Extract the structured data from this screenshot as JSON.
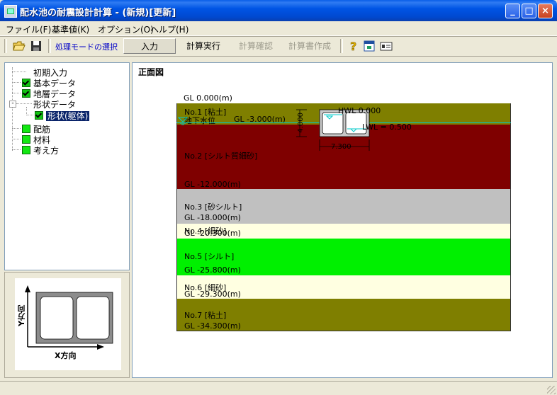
{
  "window": {
    "title": "配水池の耐震設計計算 - (新規)[更新]",
    "controls": {
      "minimize": "_",
      "maximize": "□",
      "close": "×"
    }
  },
  "menu": [
    "ファイル(F)",
    "基準値(K)",
    "オプション(O)",
    "ヘルプ(H)"
  ],
  "toolbar": {
    "mode_label": "処理モードの選択",
    "modes": [
      {
        "label": "入力",
        "state": "active"
      },
      {
        "label": "計算実行",
        "state": "enabled"
      },
      {
        "label": "計算確認",
        "state": "disabled"
      },
      {
        "label": "計算書作成",
        "state": "disabled"
      }
    ],
    "icons": [
      "open-folder-icon",
      "save-disk-icon",
      "help-question-icon",
      "window-icon",
      "card-icon"
    ]
  },
  "tree": {
    "items": [
      {
        "label": "初期入力",
        "mark": "none"
      },
      {
        "label": "基本データ",
        "mark": "checked"
      },
      {
        "label": "地層データ",
        "mark": "checked"
      },
      {
        "label": "形状データ",
        "mark": "folder",
        "expander": "-"
      },
      {
        "label": "形状(躯体)",
        "mark": "checked",
        "selected": true
      },
      {
        "label": "配筋",
        "mark": "square"
      },
      {
        "label": "材料",
        "mark": "square"
      },
      {
        "label": "考え方",
        "mark": "square"
      }
    ]
  },
  "preview": {
    "y_axis": "Y方向",
    "x_axis": "X方向"
  },
  "drawing": {
    "title": "正面図",
    "gl_top": "GL   0.000(m)",
    "structure": {
      "hwl": "HWL    0.000",
      "lwl": "LWL = 0.500",
      "groundwater": "地下水位",
      "height": "4.000",
      "width": "7.300"
    },
    "layers": [
      {
        "name": "No.1 [粘土]",
        "gl": "GL  -3.000(m)",
        "color": "#7f7f00"
      },
      {
        "name": "No.2 [シルト質細砂]",
        "gl": "GL  -12.000(m)",
        "color": "#7f0000"
      },
      {
        "name": "No.3 [砂シルト]",
        "gl": "GL  -18.000(m)",
        "color": "#c0c0c0"
      },
      {
        "name": "No.4 [細砂]",
        "gl": "GL  -20.300(m)",
        "color": "#ffffe1"
      },
      {
        "name": "No.5 [シルト]",
        "gl": "GL  -25.800(m)",
        "color": "#00f000"
      },
      {
        "name": "No.6 [細砂]",
        "gl": "GL  -29.300(m)",
        "color": "#ffffe1"
      },
      {
        "name": "No.7 [粘土]",
        "gl": "GL  -34.300(m)",
        "color": "#7f7f00"
      }
    ]
  }
}
